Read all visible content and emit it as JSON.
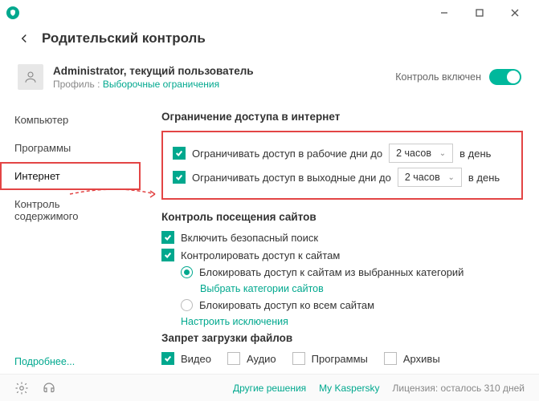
{
  "header": {
    "title": "Родительский контроль"
  },
  "profile": {
    "name": "Administrator, текущий пользователь",
    "sub_prefix": "Профиль : ",
    "sub_value": "Выборочные ограничения",
    "toggle_label": "Контроль включен"
  },
  "sidebar": {
    "items": [
      "Компьютер",
      "Программы",
      "Интернет",
      "Контроль содержимого"
    ],
    "more": "Подробнее..."
  },
  "sections": {
    "internet_limit": {
      "title": "Ограничение доступа в интернет",
      "weekday_label": "Ограничивать доступ в рабочие дни до",
      "weekend_label": "Ограничивать доступ в выходные дни до",
      "hours_value": "2 часов",
      "per_day": "в день"
    },
    "site_control": {
      "title": "Контроль посещения сайтов",
      "safe_search": "Включить безопасный поиск",
      "control_access": "Контролировать доступ к сайтам",
      "radio_block_cat": "Блокировать доступ к сайтам из выбранных категорий",
      "choose_cat": "Выбрать категории сайтов",
      "radio_block_all": "Блокировать доступ ко всем сайтам",
      "exclusions": "Настроить исключения"
    },
    "download_block": {
      "title": "Запрет загрузки файлов",
      "video": "Видео",
      "audio": "Аудио",
      "programs": "Программы",
      "archives": "Архивы"
    }
  },
  "footer": {
    "solutions": "Другие решения",
    "my": "My Kaspersky",
    "license": "Лицензия: осталось 310 дней"
  }
}
